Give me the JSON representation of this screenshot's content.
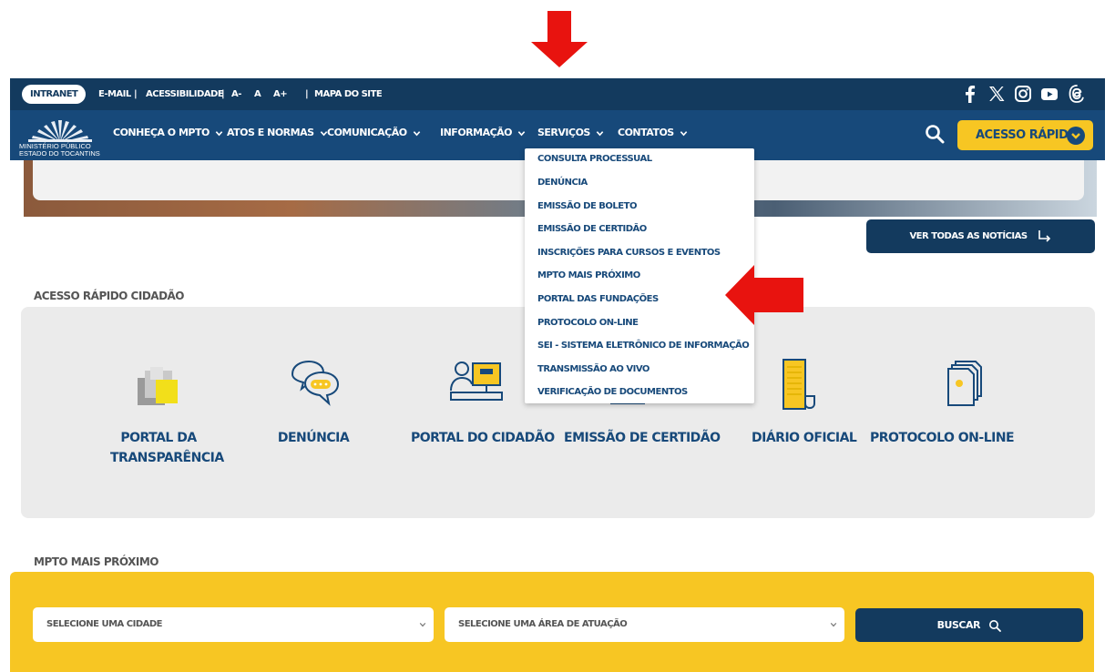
{
  "colors": {
    "navy": "#133a5e",
    "nav_blue": "#17497a",
    "yellow": "#f7c623",
    "annotation_red": "#e8130f",
    "panel_gray": "#ebebeb"
  },
  "topbar": {
    "intranet": "INTRANET",
    "email": "E-MAIL",
    "acessibilidade": "ACESSIBILIDADE",
    "font_decrease": "A-",
    "font_normal": "A",
    "font_increase": "A+",
    "mapa_site": "MAPA DO SITE",
    "separator": "|",
    "social_icons": [
      "facebook-icon",
      "x-icon",
      "instagram-icon",
      "youtube-icon",
      "threads-icon"
    ]
  },
  "header": {
    "logo_line1": "MINISTÉRIO PÚBLICO",
    "logo_line2": "ESTADO DO TOCANTINS",
    "nav": [
      {
        "label": "CONHEÇA O MPTO"
      },
      {
        "label": "ATOS E NORMAS"
      },
      {
        "label": "COMUNICAÇÃO"
      },
      {
        "label": "INFORMAÇÃO"
      },
      {
        "label": "SERVIÇOS"
      },
      {
        "label": "CONTATOS"
      }
    ],
    "search_icon": "search-icon",
    "acesso_rapido": "ACESSO RÁPIDO"
  },
  "servicos_menu": [
    "CONSULTA PROCESSUAL",
    "DENÚNCIA",
    "EMISSÃO DE BOLETO",
    "EMISSÃO DE CERTIDÃO",
    "INSCRIÇÕES PARA CURSOS E EVENTOS",
    "MPTO MAIS PRÓXIMO",
    "PORTAL DAS FUNDAÇÕES",
    "PROTOCOLO ON-LINE",
    "SEI - SISTEMA ELETRÔNICO DE INFORMAÇÃO",
    "TRANSMISSÃO AO VIVO",
    "VERIFICAÇÃO DE DOCUMENTOS"
  ],
  "news": {
    "ver_todas": "VER TODAS AS NOTÍCIAS"
  },
  "acesso_cidadao": {
    "title": "ACESSO RÁPIDO CIDADÃO",
    "items": [
      {
        "line1": "PORTAL DA",
        "line2": "TRANSPARÊNCIA",
        "icon": "transparency-icon"
      },
      {
        "line1": "DENÚNCIA",
        "line2": "",
        "icon": "chat-bubbles-icon"
      },
      {
        "line1": "PORTAL DO CIDADÃO",
        "line2": "",
        "icon": "citizen-computer-icon"
      },
      {
        "line1": "EMISSÃO DE CERTIDÃO",
        "line2": "",
        "icon": "certificate-icon"
      },
      {
        "line1": "DIÁRIO OFICIAL",
        "line2": "",
        "icon": "document-icon"
      },
      {
        "line1": "PROTOCOLO ON-LINE",
        "line2": "",
        "icon": "protocol-documents-icon"
      }
    ]
  },
  "mpto_proximo": {
    "title": "MPTO MAIS PRÓXIMO",
    "city_placeholder": "SELECIONE UMA CIDADE",
    "area_placeholder": "SELECIONE UMA ÁREA DE ATUAÇÃO",
    "buscar": "BUSCAR"
  }
}
